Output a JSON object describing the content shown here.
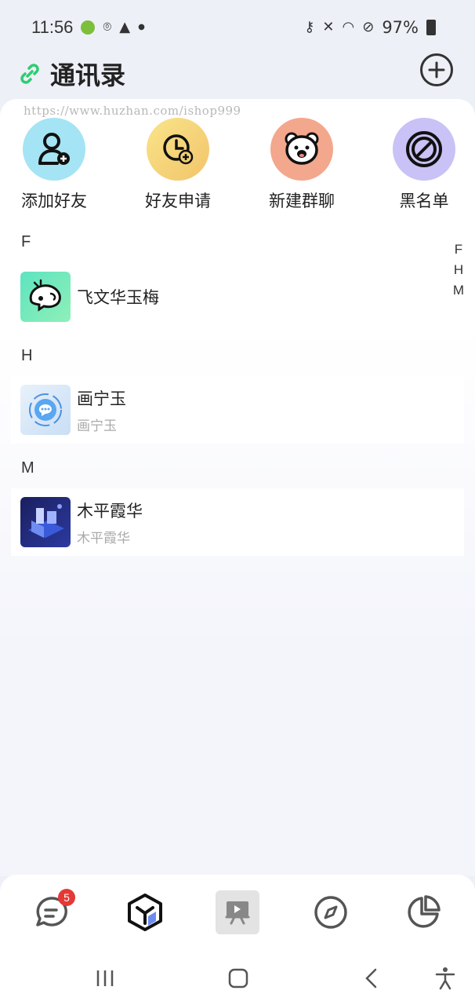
{
  "status_bar": {
    "time": "11:56",
    "battery": "97%"
  },
  "header": {
    "title": "通讯录"
  },
  "watermark": "https://www.huzhan.com/ishop999",
  "quick_actions": [
    {
      "label": "添加好友",
      "icon": "add-user-icon",
      "color": "#9fe3f2"
    },
    {
      "label": "好友申请",
      "icon": "clock-plus-icon",
      "color": "#f6d77a"
    },
    {
      "label": "新建群聊",
      "icon": "group-face-icon",
      "color": "#f2a48a"
    },
    {
      "label": "黑名单",
      "icon": "block-icon",
      "color": "#c9c3f5"
    }
  ],
  "sections": [
    {
      "letter": "F",
      "contacts": [
        {
          "name": "飞文华玉梅",
          "sub": ""
        }
      ]
    },
    {
      "letter": "H",
      "contacts": [
        {
          "name": "画宁玉",
          "sub": "画宁玉"
        }
      ]
    },
    {
      "letter": "M",
      "contacts": [
        {
          "name": "木平霞华",
          "sub": "木平霞华"
        }
      ]
    }
  ],
  "index_letters": [
    "F",
    "H",
    "M"
  ],
  "bottom_nav": {
    "items": [
      {
        "icon": "chat-icon",
        "badge": "5"
      },
      {
        "icon": "cube-icon"
      },
      {
        "icon": "video-board-icon"
      },
      {
        "icon": "compass-icon"
      },
      {
        "icon": "pie-chart-icon"
      }
    ]
  },
  "colors": {
    "accent_green": "#2ecc71",
    "badge_red": "#e53935",
    "background": "#eef0f7"
  }
}
